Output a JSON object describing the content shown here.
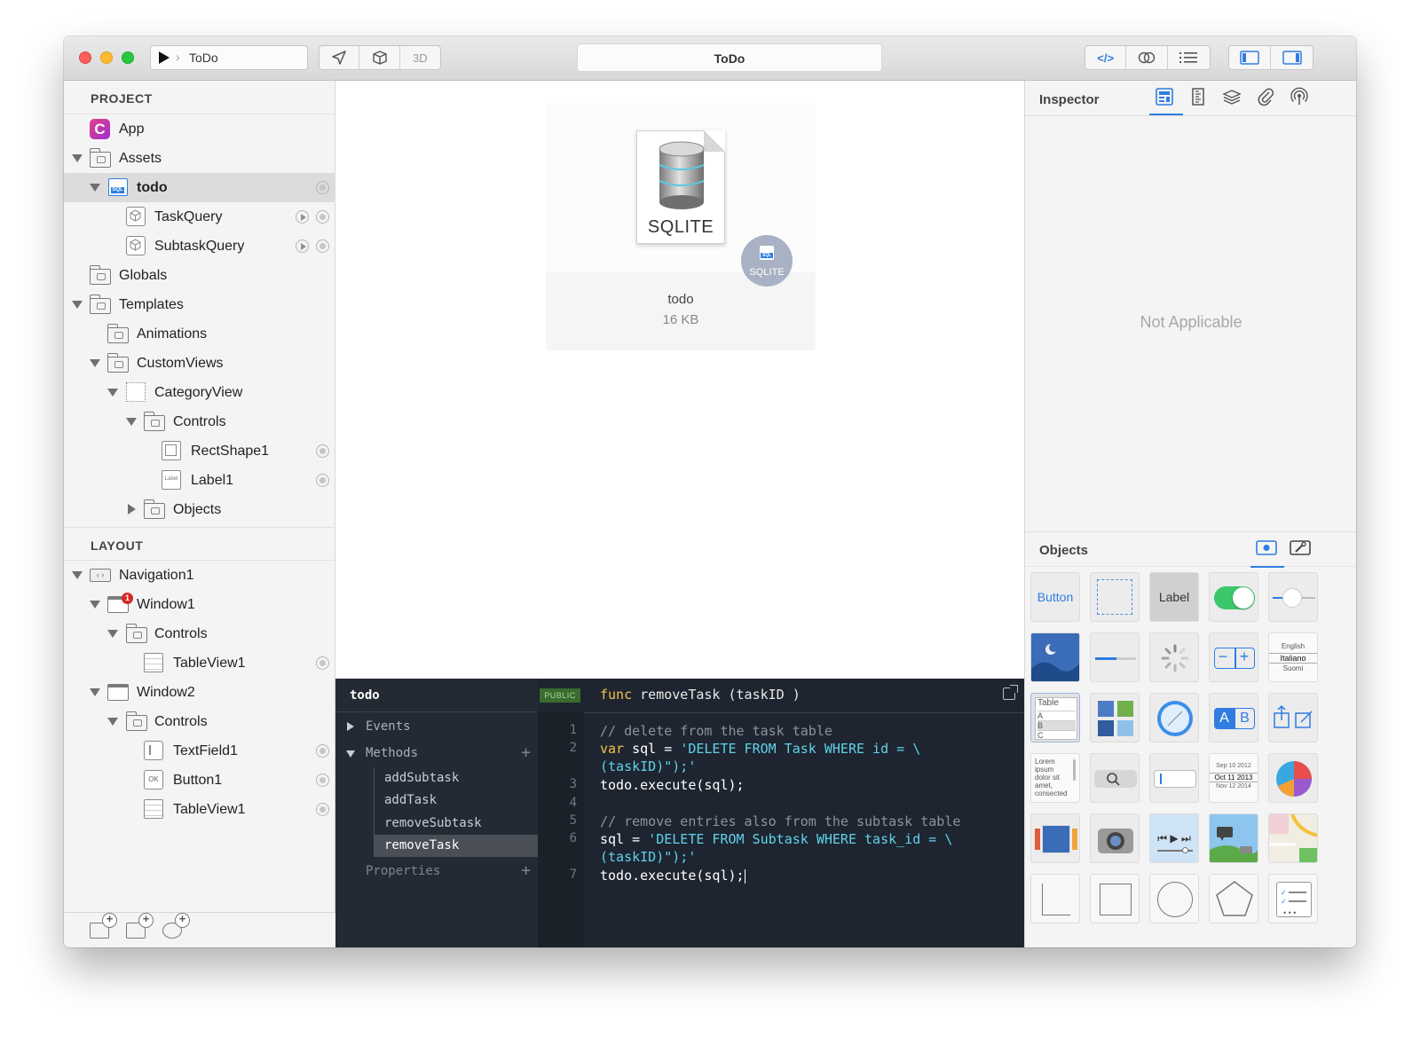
{
  "window": {
    "title": "ToDo"
  },
  "toolbar": {
    "scheme_target": "ToDo",
    "view_3d": "3D"
  },
  "sidebar": {
    "project_header": "PROJECT",
    "layout_header": "LAYOUT",
    "project_items": [
      {
        "label": "App"
      },
      {
        "label": "Assets"
      },
      {
        "label": "todo"
      },
      {
        "label": "TaskQuery"
      },
      {
        "label": "SubtaskQuery"
      },
      {
        "label": "Globals"
      },
      {
        "label": "Templates"
      },
      {
        "label": "Animations"
      },
      {
        "label": "CustomViews"
      },
      {
        "label": "CategoryView"
      },
      {
        "label": "Controls"
      },
      {
        "label": "RectShape1"
      },
      {
        "label": "Label1"
      },
      {
        "label": "Objects"
      }
    ],
    "layout_items": [
      {
        "label": "Navigation1"
      },
      {
        "label": "Window1",
        "badge": "1"
      },
      {
        "label": "Controls"
      },
      {
        "label": "TableView1"
      },
      {
        "label": "Window2"
      },
      {
        "label": "Controls"
      },
      {
        "label": "TextField1"
      },
      {
        "label": "Button1"
      },
      {
        "label": "TableView1"
      }
    ]
  },
  "asset_card": {
    "doc_label": "SQLITE",
    "badge_icon_text": "SQL",
    "badge_label": "SQLITE",
    "name": "todo",
    "size": "16 KB"
  },
  "code_panel": {
    "object_name": "todo",
    "visibility": "PUBLIC",
    "signature_keyword": "func",
    "signature": " removeTask (taskID )",
    "sections": {
      "events": "Events",
      "methods": "Methods",
      "properties": "Properties"
    },
    "methods": [
      "addSubtask",
      "addTask",
      "removeSubtask",
      "removeTask"
    ],
    "line_numbers": [
      "1",
      "2",
      "3",
      "4",
      "5",
      "6",
      "7"
    ],
    "lines": {
      "l1": "// delete from the task table",
      "l2_kw": "var",
      "l2_mid": " sql = ",
      "l2_str": "'DELETE FROM Task WHERE id = \\",
      "l2b_str": "(taskID)\");'",
      "l3": "todo.execute(sql);",
      "l5": "// remove entries also from the subtask table",
      "l6_mid": "sql = ",
      "l6_str": "'DELETE FROM Subtask WHERE task_id = \\",
      "l6b_str": "(taskID)\");'",
      "l7": "todo.execute(sql);"
    }
  },
  "inspector": {
    "title": "Inspector",
    "empty_text": "Not Applicable",
    "objects_title": "Objects"
  },
  "palette": {
    "button_label": "Button",
    "label_label": "Label",
    "segment_a": "A",
    "segment_b": "B",
    "table_label": "Table",
    "table_rows": [
      "A",
      "B",
      "C"
    ],
    "picker_rows": [
      "English",
      "Italiano",
      "Suomi"
    ],
    "date_rows": [
      "Sep 10 2012",
      "Oct 11 2013",
      "Nov 12 2014"
    ],
    "text_sample": "Lorem ipsum dolor sit amet, consected"
  },
  "colors": {
    "accent": "#2f7de1",
    "code_bg": "#1e2530",
    "keyword": "#f3c14a",
    "string": "#5fd3ec",
    "comment": "#8b939e"
  }
}
